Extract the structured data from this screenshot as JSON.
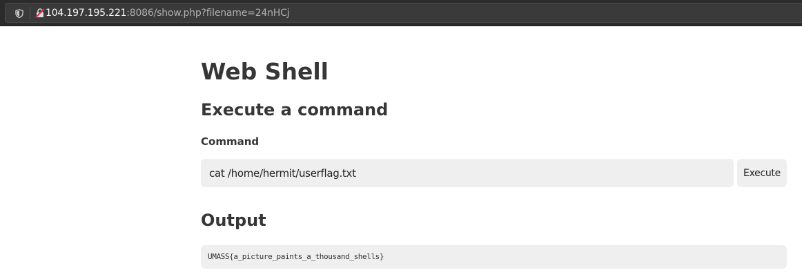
{
  "browser": {
    "url_host": "104.197.195.221",
    "url_rest": ":8086/show.php?filename=24nHCj",
    "icons": [
      "shield-icon",
      "insecure-lock-icon"
    ]
  },
  "page": {
    "title": "Web Shell",
    "section_heading": "Execute a command",
    "command_label": "Command",
    "command_value": "cat /home/hermit/userflag.txt",
    "execute_label": "Execute",
    "output_heading": "Output",
    "output_text": "UMASS{a_picture_paints_a_thousand_shells}"
  }
}
